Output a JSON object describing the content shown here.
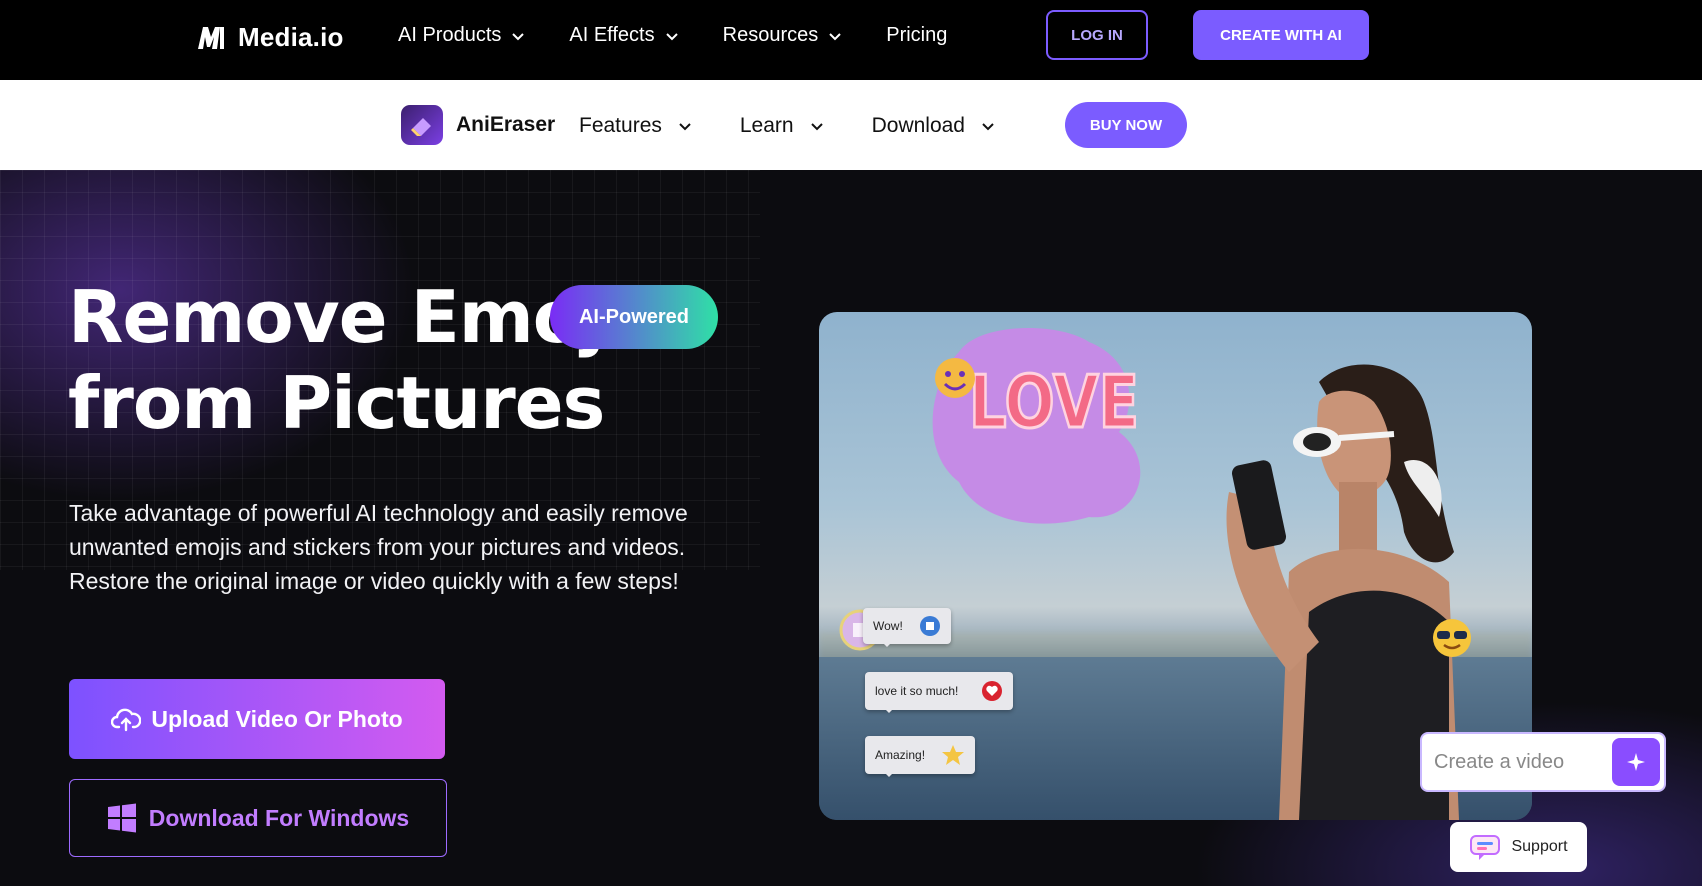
{
  "topbar": {
    "brand": "Media.io",
    "nav": [
      {
        "label": "AI Products",
        "dropdown": true
      },
      {
        "label": "AI Effects",
        "dropdown": true
      },
      {
        "label": "Resources",
        "dropdown": true
      },
      {
        "label": "Pricing",
        "dropdown": false
      }
    ],
    "login_label": "LOG IN",
    "create_label": "CREATE WITH AI"
  },
  "subnav": {
    "brand": "AniEraser",
    "items": [
      {
        "label": "Features"
      },
      {
        "label": "Learn"
      },
      {
        "label": "Download"
      }
    ],
    "buy_label": "BUY NOW"
  },
  "hero": {
    "title_line1": "Remove Emoji",
    "title_line2": "from Pictures",
    "badge": "AI-Powered",
    "description": "Take advantage of powerful AI technology and easily remove unwanted emojis and stickers from your pictures and videos. Restore the original image or video quickly with a few steps!",
    "upload_label": "Upload Video Or Photo",
    "download_label": "Download For Windows"
  },
  "image": {
    "sticker_text": "LOVE",
    "bubbles": [
      "Wow!",
      "love it so much!",
      "Amazing!"
    ]
  },
  "create_video": {
    "placeholder": "Create a video"
  },
  "support": {
    "label": "Support"
  },
  "colors": {
    "accent": "#7b5cff",
    "badge_start": "#7a2cf5",
    "badge_end": "#2fe0a6",
    "upload_gradient_end": "#d35bf0"
  }
}
